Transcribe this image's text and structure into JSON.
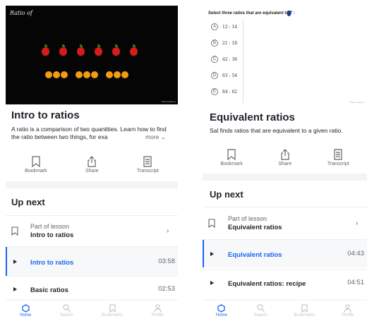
{
  "left": {
    "video": {
      "title_text": "Ratio of",
      "apple_count": 6,
      "orange_count": 9,
      "credit": "Khan Academy"
    },
    "lesson_title": "Intro to ratios",
    "description": "A ratio is a comparison of two quantities.  Learn how to find the ratio between two things, for exa",
    "more_label": "more",
    "actions": {
      "bookmark": "Bookmark",
      "share": "Share",
      "transcript": "Transcript"
    },
    "up_next_title": "Up next",
    "part_label": "Part of lesson",
    "part_name": "Intro to ratios",
    "videos": [
      {
        "title": "Intro to ratios",
        "duration": "03:58",
        "active": true
      },
      {
        "title": "Basic ratios",
        "duration": "02:53",
        "active": false
      }
    ],
    "tabs": {
      "home": "Home",
      "search": "Search",
      "bookmarks": "Bookmarks",
      "profile": "Profile"
    }
  },
  "right": {
    "video": {
      "question": "Select three ratios that are equivalent to 7 :",
      "options": [
        {
          "letter": "A",
          "value": "12 : 14"
        },
        {
          "letter": "B",
          "value": "21 : 18"
        },
        {
          "letter": "C",
          "value": "42 : 36"
        },
        {
          "letter": "D",
          "value": "63 : 54"
        },
        {
          "letter": "E",
          "value": "84 : 62"
        }
      ],
      "credit": "Khan Academy"
    },
    "lesson_title": "Equivalent ratios",
    "description": "Sal finds ratios that are equivalent to a given ratio.",
    "actions": {
      "bookmark": "Bookmark",
      "share": "Share",
      "transcript": "Transcript"
    },
    "up_next_title": "Up next",
    "part_label": "Part of lesson",
    "part_name": "Equivalent ratios",
    "videos": [
      {
        "title": "Equivalent ratios",
        "duration": "04:43",
        "active": true
      },
      {
        "title": "Equivalent ratios: recipe",
        "duration": "04:51",
        "active": false
      }
    ],
    "tabs": {
      "home": "Home",
      "search": "Search",
      "bookmarks": "Bookmarks",
      "profile": "Profile"
    }
  },
  "colors": {
    "accent": "#1865f2",
    "text": "#21242c",
    "muted": "#626569",
    "tab_inactive": "#c4c6ca"
  },
  "icons": [
    "bookmark-icon",
    "share-icon",
    "transcript-icon",
    "chevron-right-icon",
    "play-icon",
    "home-icon",
    "search-icon",
    "bookmarks-tab-icon",
    "profile-icon"
  ]
}
